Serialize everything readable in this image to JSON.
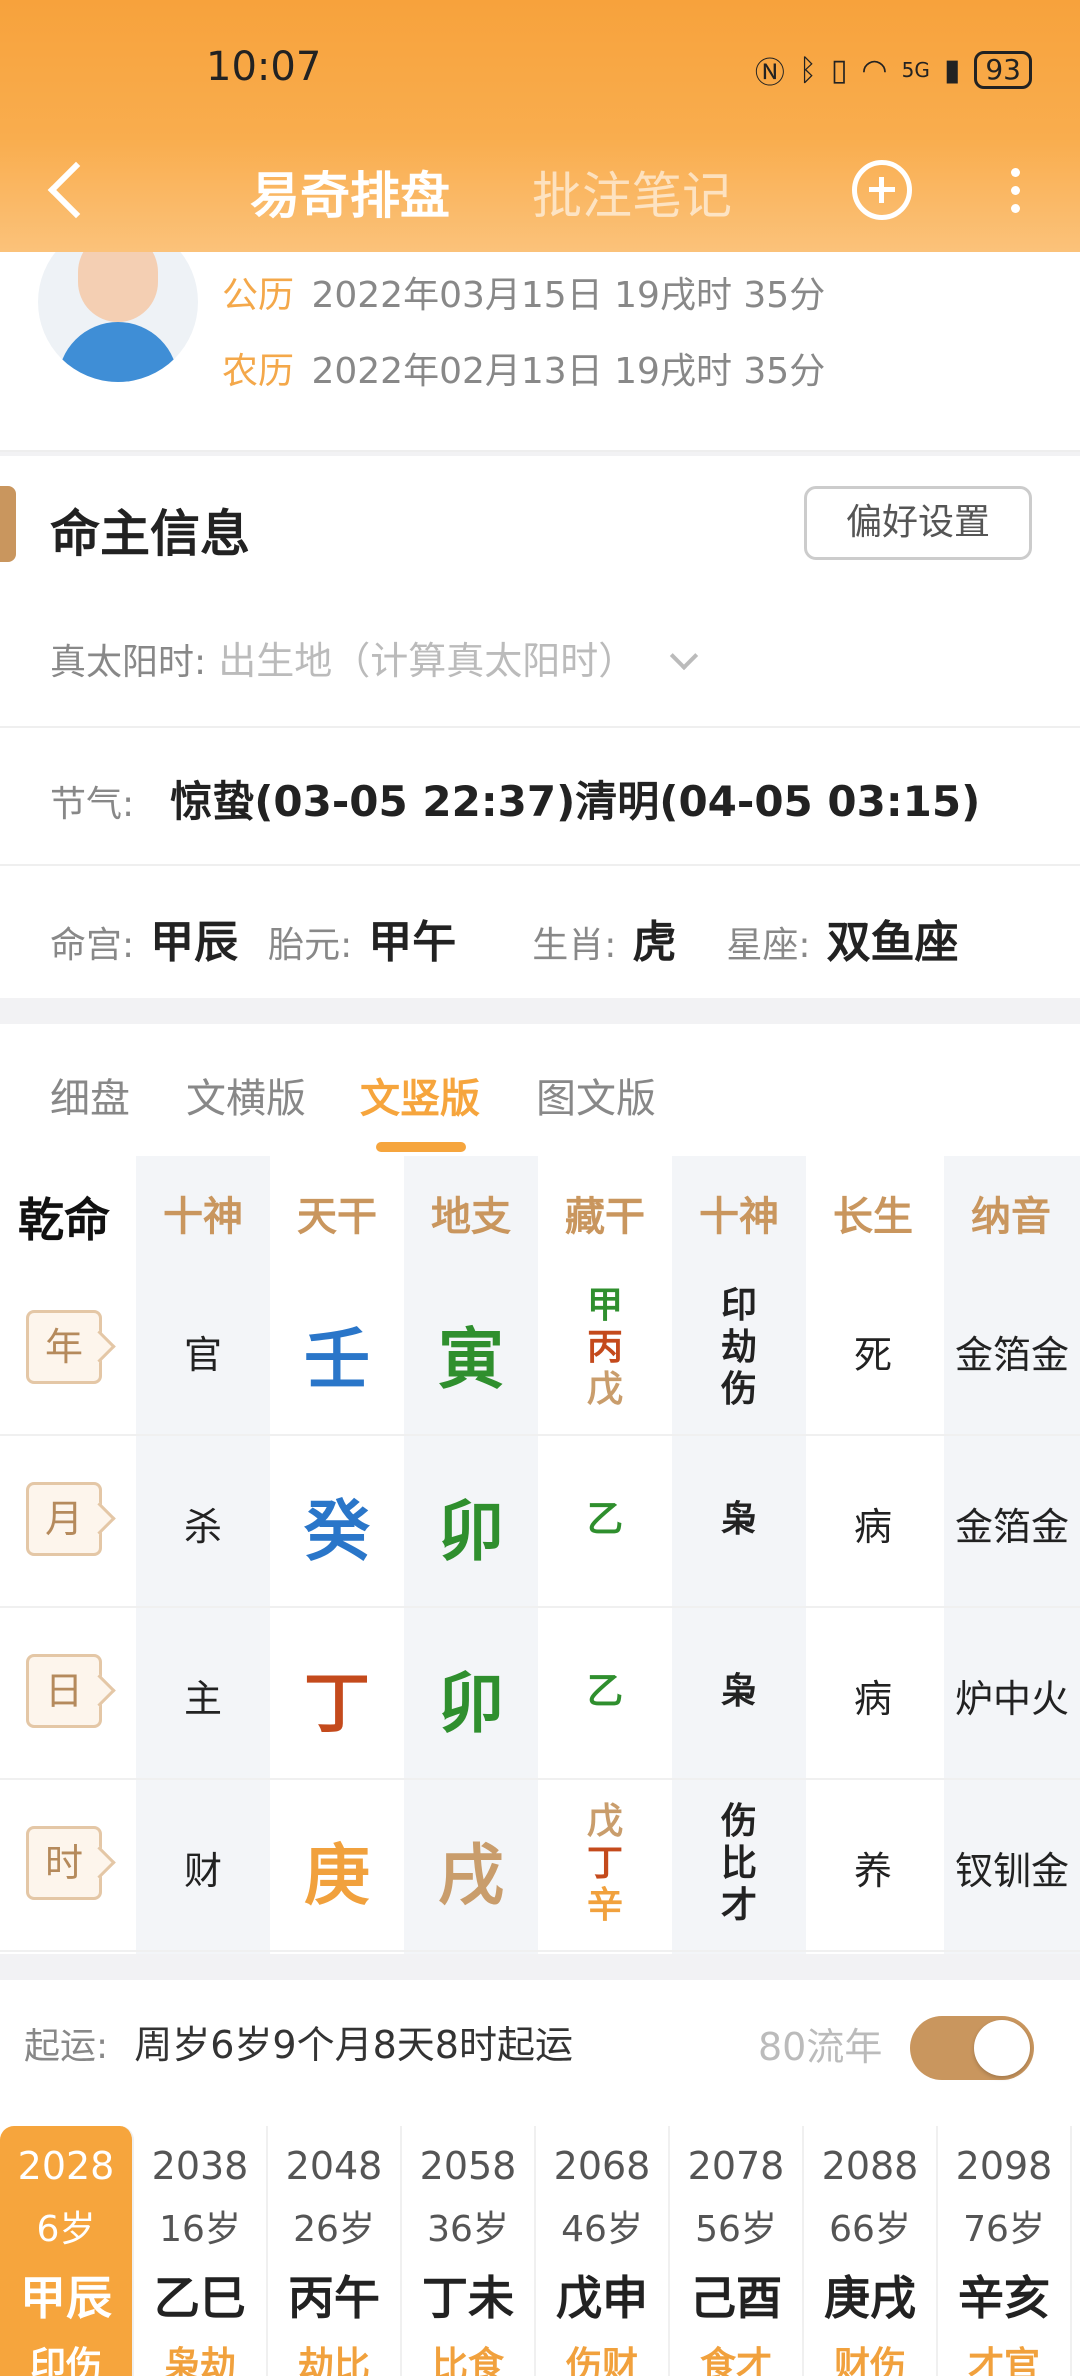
{
  "status": {
    "time": "10:07",
    "battery": "93",
    "network": "5G"
  },
  "header": {
    "tab_main": "易奇排盘",
    "tab_notes": "批注笔记"
  },
  "profile": {
    "solar_label": "公历",
    "solar_value": "2022年03月15日 19戌时 35分",
    "lunar_label": "农历",
    "lunar_value": "2022年02月13日 19戌时 35分"
  },
  "section": {
    "title": "命主信息",
    "pref_button": "偏好设置",
    "solar_time_label": "真太阳时:",
    "solar_time_placeholder": "出生地（计算真太阳时）",
    "jieqi_label": "节气:",
    "jieqi_value": "惊蛰(03-05 22:37)清明(04-05 03:15)",
    "minggong_label": "命宫:",
    "minggong_value": "甲辰",
    "taiyuan_label": "胎元:",
    "taiyuan_value": "甲午",
    "shengxiao_label": "生肖:",
    "shengxiao_value": "虎",
    "xingzuo_label": "星座:",
    "xingzuo_value": "双鱼座"
  },
  "chart": {
    "view_tabs": [
      "细盘",
      "文横版",
      "文竖版",
      "图文版"
    ],
    "active_tab": 2,
    "corner_label": "乾命",
    "headers": [
      "十神",
      "天干",
      "地支",
      "藏干",
      "十神",
      "长生",
      "纳音"
    ],
    "pillars": [
      {
        "name": "年",
        "shishen": "官",
        "gan": "壬",
        "gan_color": "blue",
        "zhi": "寅",
        "zhi_color": "green",
        "canggan": [
          "甲",
          "丙",
          "戊"
        ],
        "canggan_colors": [
          "green",
          "red",
          "tan"
        ],
        "zhi_shishen": [
          "印",
          "劫",
          "伤"
        ],
        "changsheng": "死",
        "nayin": "金箔金"
      },
      {
        "name": "月",
        "shishen": "杀",
        "gan": "癸",
        "gan_color": "blue",
        "zhi": "卯",
        "zhi_color": "green",
        "canggan": [
          "乙"
        ],
        "canggan_colors": [
          "green"
        ],
        "zhi_shishen": [
          "枭"
        ],
        "changsheng": "病",
        "nayin": "金箔金"
      },
      {
        "name": "日",
        "shishen": "主",
        "gan": "丁",
        "gan_color": "red",
        "zhi": "卯",
        "zhi_color": "green",
        "canggan": [
          "乙"
        ],
        "canggan_colors": [
          "green"
        ],
        "zhi_shishen": [
          "枭"
        ],
        "changsheng": "病",
        "nayin": "炉中火"
      },
      {
        "name": "时",
        "shishen": "财",
        "gan": "庚",
        "gan_color": "orange",
        "zhi": "戌",
        "zhi_color": "tan",
        "canggan": [
          "戊",
          "丁",
          "辛"
        ],
        "canggan_colors": [
          "tan",
          "red",
          "orange"
        ],
        "zhi_shishen": [
          "伤",
          "比",
          "才"
        ],
        "changsheng": "养",
        "nayin": "钗钏金"
      }
    ]
  },
  "luck": {
    "qiyun_label": "起运:",
    "qiyun_value": "周岁6岁9个月8天8时起运",
    "liunian_label": "80流年",
    "dayun": [
      {
        "year": "2028",
        "age": "6岁",
        "ganzhi": "甲辰",
        "shishen": "印伤"
      },
      {
        "year": "2038",
        "age": "16岁",
        "ganzhi": "乙巳",
        "shishen": "枭劫"
      },
      {
        "year": "2048",
        "age": "26岁",
        "ganzhi": "丙午",
        "shishen": "劫比"
      },
      {
        "year": "2058",
        "age": "36岁",
        "ganzhi": "丁未",
        "shishen": "比食"
      },
      {
        "year": "2068",
        "age": "46岁",
        "ganzhi": "戊申",
        "shishen": "伤财"
      },
      {
        "year": "2078",
        "age": "56岁",
        "ganzhi": "己酉",
        "shishen": "食才"
      },
      {
        "year": "2088",
        "age": "66岁",
        "ganzhi": "庚戌",
        "shishen": "财伤"
      },
      {
        "year": "2098",
        "age": "76岁",
        "ganzhi": "辛亥",
        "shishen": "才官"
      }
    ],
    "active_index": 0
  },
  "colors": {
    "blue": "#2a76c9",
    "green": "#2f8f2e",
    "red": "#c44a1c",
    "orange": "#f1a13d",
    "tan": "#c99d6c",
    "accent": "#f6a53d"
  }
}
